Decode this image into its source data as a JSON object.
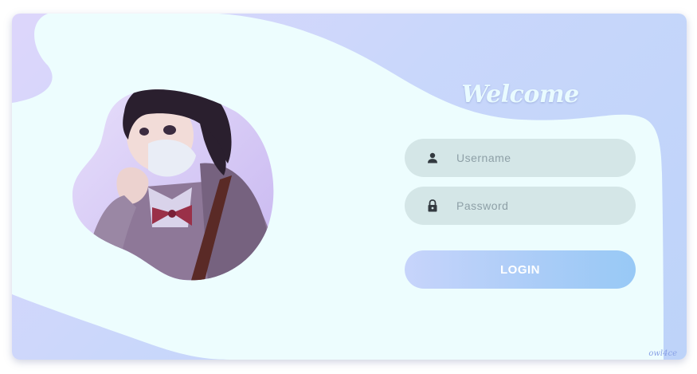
{
  "welcome": {
    "title": "Welcome"
  },
  "form": {
    "username": {
      "placeholder": "Username",
      "value": "",
      "icon": "user-icon"
    },
    "password": {
      "placeholder": "Password",
      "value": "",
      "icon": "lock-icon"
    },
    "login_label": "LOGIN"
  },
  "signature": "owl4ce",
  "colors": {
    "background_gradient": [
      "#ddd6fb",
      "#bdd3f9"
    ],
    "blob": "#edfdfe",
    "field_bg": "#d4e6e7",
    "button_gradient": [
      "#c7d4fb",
      "#98c9f6"
    ],
    "icon": "#333a40"
  }
}
